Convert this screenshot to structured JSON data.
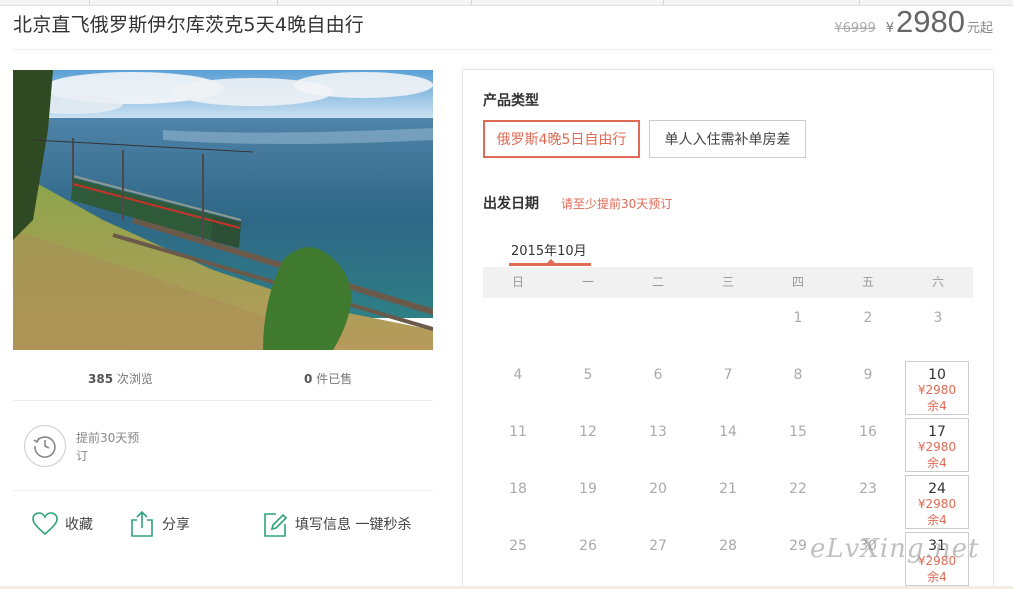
{
  "product": {
    "title": "北京直飞俄罗斯伊尔库茨克5天4晚自由行",
    "original_price": "¥6999",
    "currency_symbol": "¥",
    "price": "2980",
    "price_suffix": "元起"
  },
  "stats": {
    "views_count": "385",
    "views_label": "次浏览",
    "sold_count": "0",
    "sold_label": "件已售"
  },
  "booking_notice": "提前30天预订",
  "actions": {
    "favorite": "收藏",
    "share": "分享",
    "quick_buy": "填写信息 一键秒杀"
  },
  "product_type": {
    "label": "产品类型",
    "options": [
      "俄罗斯4晚5日自由行",
      "单人入住需补单房差"
    ],
    "selected": "俄罗斯4晚5日自由行"
  },
  "departure": {
    "label": "出发日期",
    "note": "请至少提前30天预订",
    "month": "2015年10月",
    "weekdays": [
      "日",
      "一",
      "二",
      "三",
      "四",
      "五",
      "六"
    ],
    "days": [
      {
        "day": "1"
      },
      {
        "day": "2"
      },
      {
        "day": "3"
      },
      {
        "day": "4"
      },
      {
        "day": "5"
      },
      {
        "day": "6"
      },
      {
        "day": "7"
      },
      {
        "day": "8"
      },
      {
        "day": "9"
      },
      {
        "day": "10",
        "price": "¥2980",
        "remaining": "余4"
      },
      {
        "day": "11"
      },
      {
        "day": "12"
      },
      {
        "day": "13"
      },
      {
        "day": "14"
      },
      {
        "day": "15"
      },
      {
        "day": "16"
      },
      {
        "day": "17",
        "price": "¥2980",
        "remaining": "余4"
      },
      {
        "day": "18"
      },
      {
        "day": "19"
      },
      {
        "day": "20"
      },
      {
        "day": "21"
      },
      {
        "day": "22"
      },
      {
        "day": "23"
      },
      {
        "day": "24",
        "price": "¥2980",
        "remaining": "余4"
      },
      {
        "day": "25"
      },
      {
        "day": "26"
      },
      {
        "day": "27"
      },
      {
        "day": "28"
      },
      {
        "day": "29"
      },
      {
        "day": "30"
      },
      {
        "day": "31",
        "price": "¥2980",
        "remaining": "余4"
      }
    ]
  },
  "watermark": "eLvXing.net",
  "colors": {
    "accent": "#e06a55",
    "icon_green": "#2ea37a"
  }
}
